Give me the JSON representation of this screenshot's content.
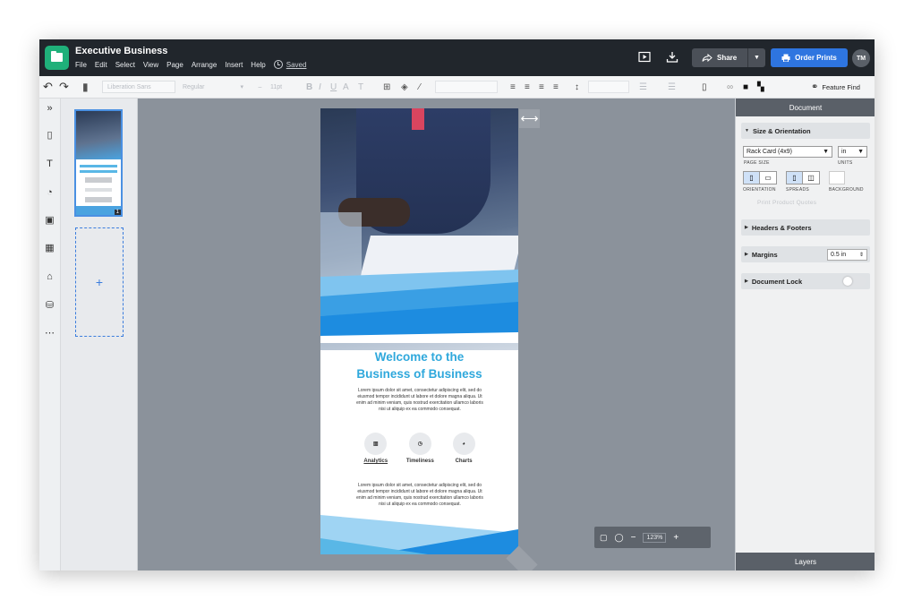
{
  "app": {
    "doc_title": "Executive Business",
    "saved": "Saved",
    "avatar": "TM",
    "share": "Share",
    "order_prints": "Order Prints"
  },
  "menu": [
    "File",
    "Edit",
    "Select",
    "View",
    "Page",
    "Arrange",
    "Insert",
    "Help"
  ],
  "toolbar": {
    "font": "Liberation Sans",
    "style": "Regular",
    "size": "11pt",
    "feature_find": "Feature Find"
  },
  "pages": {
    "page_number": "1",
    "add": "+"
  },
  "document": {
    "welcome_line1": "Welcome to the",
    "welcome_line2": "Business of Business",
    "body1": "Lorem ipsum dolor sit amet, consectetur adipiscing elit, sed do eiusmod tempor incididunt ut labore et dolore magna aliqua. Ut enim ad minim veniam, quis nostrud exercitation ullamco laboris nisi ut aliquip ex ea commodo consequat.",
    "body2": "Lorem ipsum dolor sit amet, consectetur adipiscing elit, sed do eiusmod tempor incididunt ut labore et dolore magna aliqua. Ut enim ad minim veniam, quis nostrud exercitation ullamco laboris nisi ut aliquip ex ea commodo consequat.",
    "icons": [
      "Analytics",
      "Timeliness",
      "Charts"
    ]
  },
  "zoom": {
    "value": "123%"
  },
  "panel": {
    "header": "Document",
    "size_orientation": "Size & Orientation",
    "page_size": "Rack Card (4x9)",
    "page_size_label": "PAGE SIZE",
    "units": "in",
    "units_label": "UNITS",
    "orientation_label": "ORIENTATION",
    "spreads_label": "SPREADS",
    "background_label": "BACKGROUND",
    "print_quotes": "Print Product Quotes",
    "headers_footers": "Headers & Footers",
    "margins": "Margins",
    "margins_value": "0.5 in",
    "document_lock": "Document Lock",
    "layers": "Layers"
  }
}
